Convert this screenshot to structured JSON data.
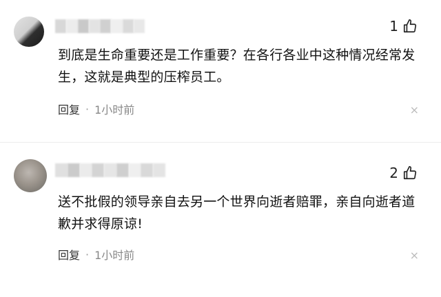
{
  "comments": [
    {
      "likes": "1",
      "text": "到底是生命重要还是工作重要？在各行各业中这种情况经常发生，这就是典型的压榨员工。",
      "reply_label": "回复",
      "dot": "·",
      "time": "1小时前",
      "close": "×"
    },
    {
      "likes": "2",
      "text": "送不批假的领导亲自去另一个世界向逝者赔罪，亲自向逝者道歉并求得原谅!",
      "reply_label": "回复",
      "dot": "·",
      "time": "1小时前",
      "close": "×"
    }
  ],
  "icons": {
    "like": "thumbs-up-icon",
    "close": "close-icon"
  },
  "colors": {
    "text": "#111111",
    "meta": "#888888",
    "background": "#ffffff"
  }
}
